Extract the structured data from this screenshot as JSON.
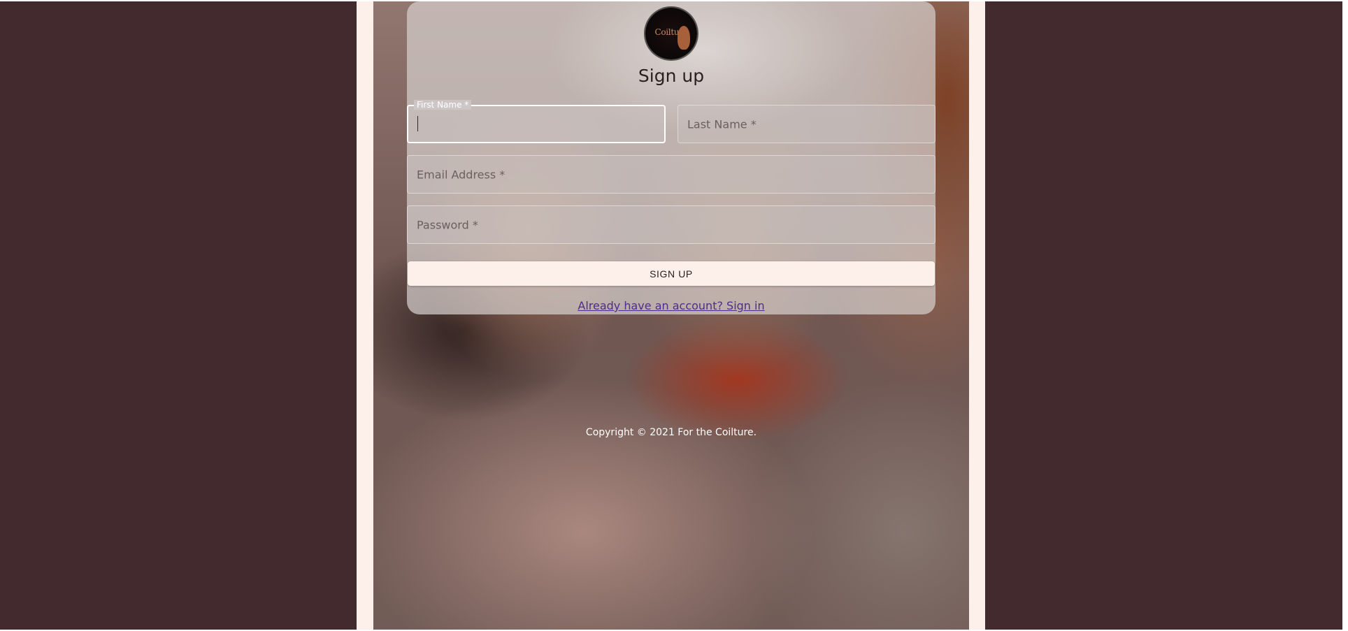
{
  "brand": {
    "logo_text": "Coilture",
    "logo_icon": "woman-silhouette-icon"
  },
  "form": {
    "title": "Sign up",
    "first_name": {
      "label": "First Name *",
      "value": ""
    },
    "last_name": {
      "placeholder": "Last Name *"
    },
    "email": {
      "placeholder": "Email Address *"
    },
    "password": {
      "placeholder": "Password *"
    },
    "submit_label": "SIGN UP",
    "signin_link": "Already have an account? Sign in"
  },
  "footer": {
    "copyright": "Copyright © 2021 For the Coilture."
  },
  "colors": {
    "outer_bg": "#432a2e",
    "column_bg": "#fdf0ea",
    "button_bg": "#fdf0ea",
    "link": "#4e2c8c"
  }
}
